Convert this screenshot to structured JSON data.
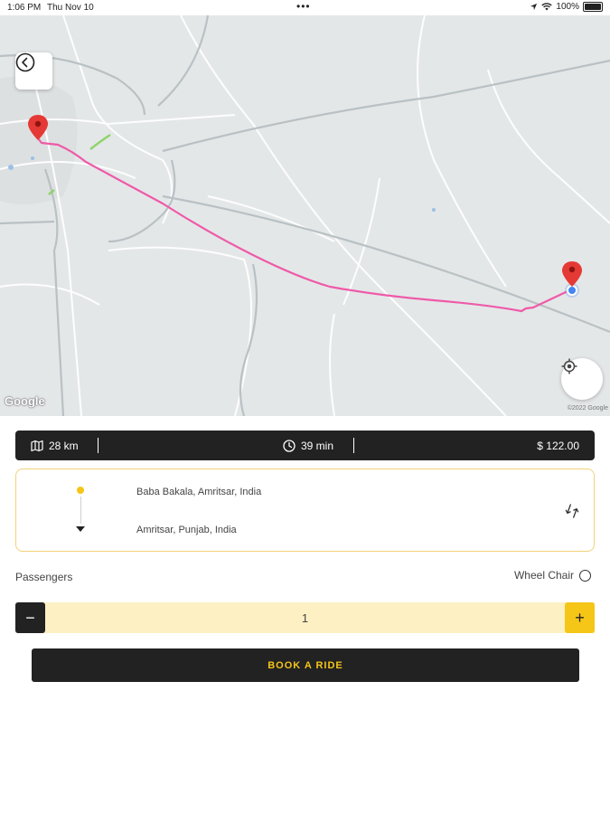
{
  "status_bar": {
    "time": "1:06 PM",
    "date": "Thu Nov 10",
    "dots": "•••",
    "battery": "100%"
  },
  "map": {
    "google_logo": "Google",
    "credit": "©2022 Google",
    "icons": {
      "back": "chevron-left-icon",
      "locate": "my-location-icon",
      "origin_pin": "map-pin-icon",
      "destination_pin": "map-pin-icon"
    },
    "route_color": "#ef5aa8"
  },
  "trip_info": {
    "distance": "28 km",
    "duration": "39 min",
    "fare": "$ 122.00"
  },
  "route": {
    "from": "Baba Bakala, Amritsar, India",
    "to": "Amritsar, Punjab, India"
  },
  "passengers": {
    "label": "Passengers",
    "wheelchair_label": "Wheel Chair",
    "count": "1",
    "minus": "−",
    "plus": "+"
  },
  "actions": {
    "book": "BOOK A RIDE"
  },
  "colors": {
    "accent": "#f5c518",
    "dark": "#222222",
    "stepper_bg": "#fdf1c4",
    "card_border": "#f2d27a"
  }
}
